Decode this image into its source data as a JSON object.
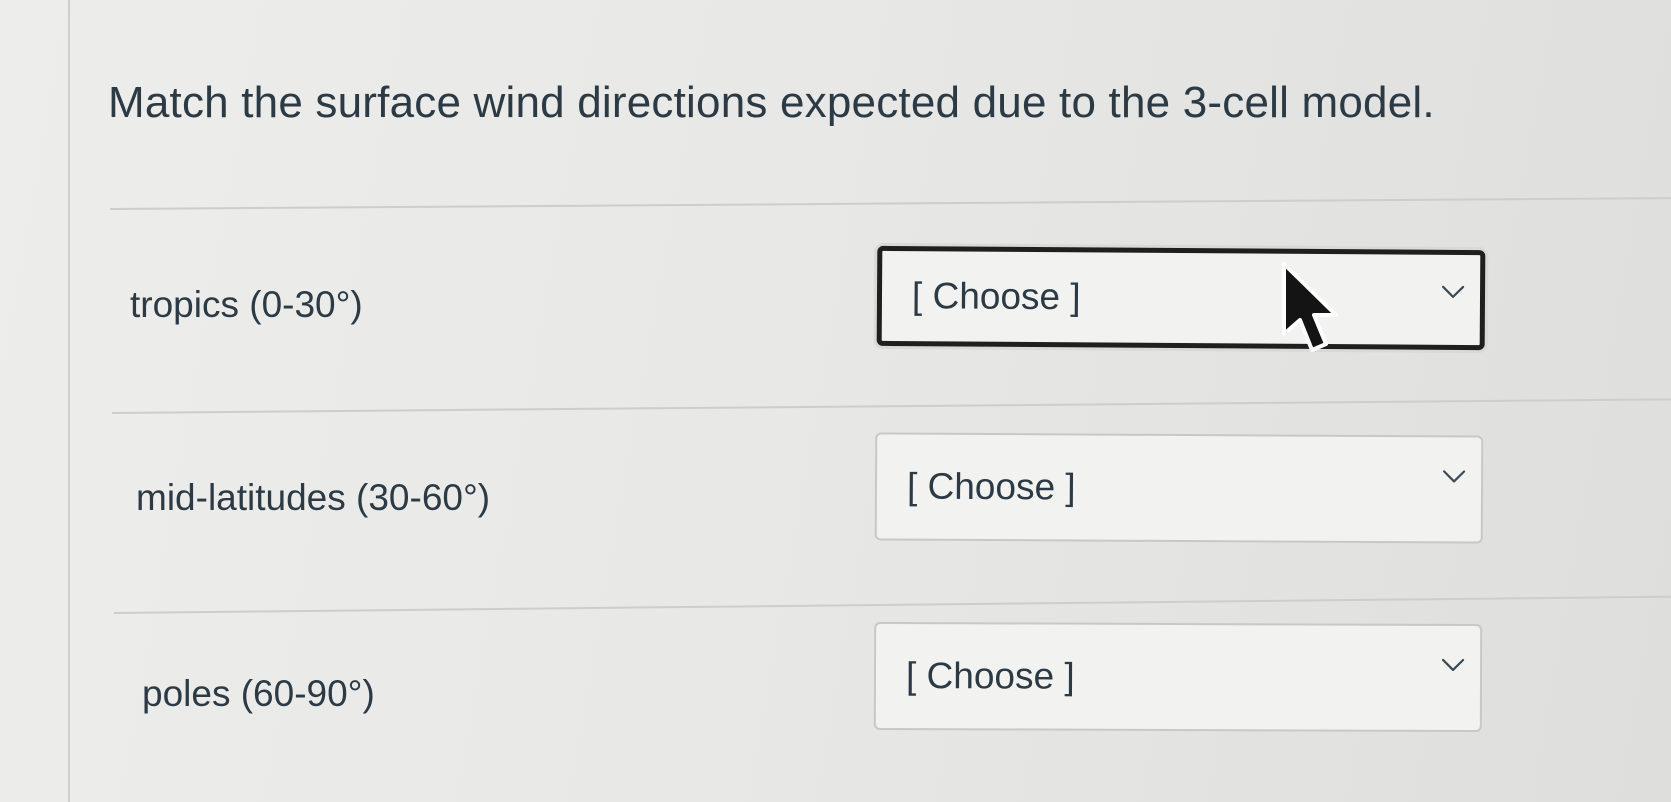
{
  "question": {
    "text": "Match the surface wind directions expected due to the 3-cell model."
  },
  "rows": [
    {
      "label": "tropics (0-30°)",
      "select_value": "[ Choose ]"
    },
    {
      "label": "mid-latitudes (30-60°)",
      "select_value": "[ Choose ]"
    },
    {
      "label": "poles (60-90°)",
      "select_value": "[ Choose ]"
    }
  ],
  "icons": {
    "dropdown": "chevron-down-icon",
    "pointer": "mouse-cursor-icon"
  },
  "colors": {
    "text": "#2b3a44",
    "focus_border": "#1f1f1f",
    "select_border": "#c8c8c6",
    "background": "#e9e9e7"
  }
}
